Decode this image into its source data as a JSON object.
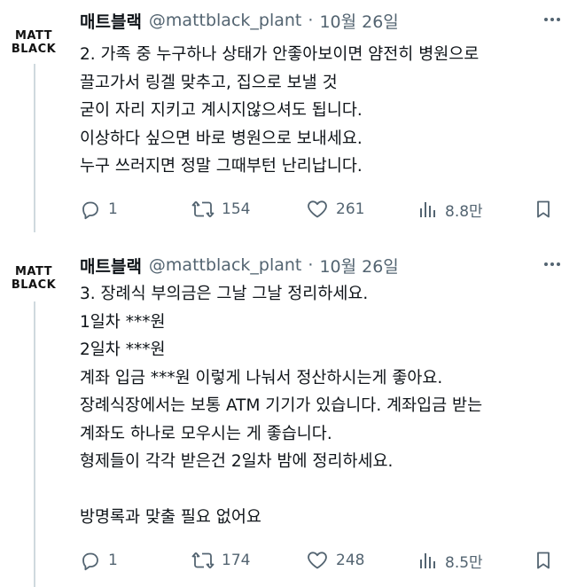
{
  "tweets": [
    {
      "avatar": {
        "line1": "MATT",
        "line2": "BLACK"
      },
      "display_name": "매트블랙",
      "handle": "@mattblack_plant",
      "separator": "·",
      "date": "10월 26일",
      "lines": [
        "2. 가족 중 누구하나 상태가 안좋아보이면 얌전히 병원으로",
        "끌고가서 링겔 맞추고, 집으로 보낼 것",
        "굳이 자리 지키고 계시지않으셔도 됩니다.",
        "이상하다 싶으면 바로 병원으로 보내세요.",
        "누구 쓰러지면 정말 그때부턴 난리납니다."
      ],
      "stats": {
        "replies": "1",
        "retweets": "154",
        "likes": "261",
        "views": "8.8만"
      }
    },
    {
      "avatar": {
        "line1": "MATT",
        "line2": "BLACK"
      },
      "display_name": "매트블랙",
      "handle": "@mattblack_plant",
      "separator": "·",
      "date": "10월 26일",
      "lines": [
        "3. 장례식 부의금은 그날 그날 정리하세요.",
        "1일차 ***원",
        "2일차 ***원",
        "계좌 입금 ***원 이렇게 나눠서 정산하시는게 좋아요.",
        "장례식장에서는 보통 ATM 기기가 있습니다. 계좌입금 받는",
        "계좌도 하나로 모우시는 게 좋습니다.",
        "형제들이 각각 받은건 2일차 밤에 정리하세요.",
        "",
        "방명록과 맞출 필요 없어요"
      ],
      "stats": {
        "replies": "1",
        "retweets": "174",
        "likes": "248",
        "views": "8.5만"
      }
    }
  ],
  "icons": {
    "more": "more-horizontal-icon",
    "reply": "reply-icon",
    "retweet": "retweet-icon",
    "like": "heart-icon",
    "views": "views-chart-icon",
    "bookmark": "bookmark-icon"
  },
  "colors": {
    "text": "#0f1419",
    "secondary": "#536471",
    "thread_line": "#cfd9de"
  }
}
